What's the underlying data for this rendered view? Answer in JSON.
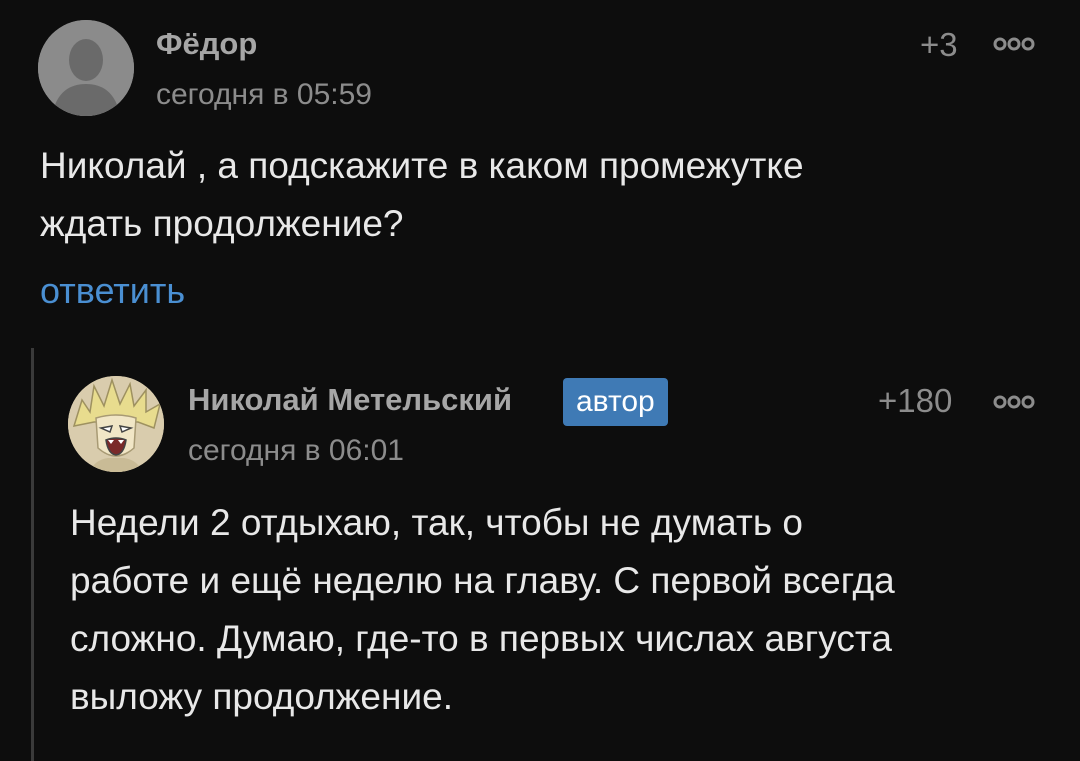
{
  "comments": [
    {
      "author": "Фёдор",
      "time": "сегодня в 05:59",
      "rating": "+3",
      "text_lines": [
        "Николай , а подскажите в каком промежутке",
        "ждать продолжение?"
      ],
      "reply_label": "ответить",
      "avatar_icon": "user-silhouette-icon",
      "more_icon": "more-dots-icon"
    },
    {
      "author": "Николай Метельский",
      "badge": "автор",
      "time": "сегодня в 06:01",
      "rating": "+180",
      "text_lines": [
        "Недели 2 отдыхаю, так, чтобы не думать о",
        "работе и ещё неделю на главу. С первой всегда",
        "сложно. Думаю, где-то в первых числах августа",
        "выложу продолжение."
      ],
      "avatar_icon": "anime-character-avatar",
      "more_icon": "more-dots-icon"
    }
  ],
  "colors": {
    "background": "#0d0d0d",
    "link": "#4a8fd2",
    "badge": "#3f7ab5",
    "muted": "#8c8c8c",
    "thread_line": "#3a3a3a"
  }
}
